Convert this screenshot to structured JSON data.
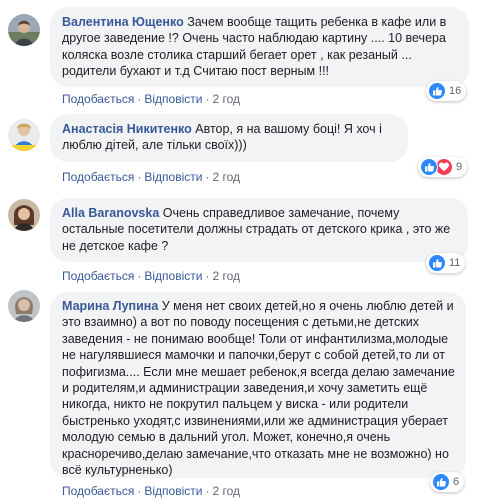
{
  "comments": [
    {
      "author": "Валентина Ющенко",
      "text": "Зачем вообще тащить ребенка в кафе или в другое заведение !? Очень часто наблюдаю картину .... 10 вечера коляска возле столика старший бегает орет , как резаный ... родители бухают и т.д Считаю пост верным !!!",
      "like_label": "Подобається",
      "reply_label": "Відповісти",
      "time": "2 год",
      "reactions": [
        "like"
      ],
      "reaction_count": "16"
    },
    {
      "author": "Анастасія Никитенко",
      "text": "Автор, я на вашому боці! Я хоч і люблю дітей, але тільки своїх)))",
      "like_label": "Подобається",
      "reply_label": "Відповісти",
      "time": "2 год",
      "reactions": [
        "like",
        "love"
      ],
      "reaction_count": "9"
    },
    {
      "author": "Alla Baranovska",
      "text": "Очень справедливое замечание, почему остальные посетители должны страдать от детского крика , это же не детское кафе ?",
      "like_label": "Подобається",
      "reply_label": "Відповісти",
      "time": "2 год",
      "reactions": [
        "like"
      ],
      "reaction_count": "11"
    },
    {
      "author": "Марина Лупина",
      "text": "У меня нет своих детей,но я очень люблю детей и это взаимно) а вот по поводу посещения с детьми,не детских заведения - не понимаю вообще! Толи от инфантилизма,молодые не нагулявшиеся мамочки и папочки,берут с собой детей,то ли от пофигизма.... Если мне мешает ребенок,я всегда делаю замечание и родителям,и администрации заведения,и хочу заметить ещё никогда, никто не покрутил пальцем у виска - или родители быстренько уходят,с извинениями,или же администрация уберает молодую семью в дальний угол. Может, конечно,я очень красноречиво,делаю замечание,что отказать мне не возможно) но всё культурненько)",
      "like_label": "Подобається",
      "reply_label": "Відповісти",
      "time": "2 год",
      "reactions": [
        "like"
      ],
      "reaction_count": "6"
    }
  ],
  "colors": {
    "author": "#385898",
    "bubble": "#f2f3f5",
    "like": "#2d88ff",
    "love": "#f33e58"
  }
}
